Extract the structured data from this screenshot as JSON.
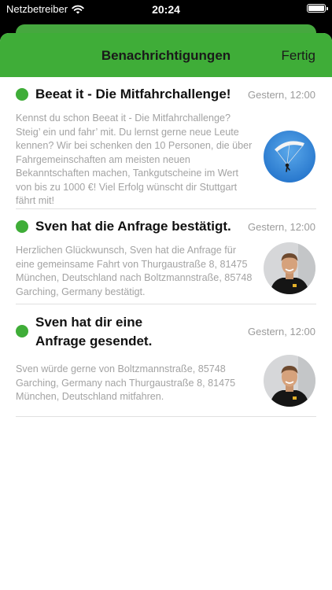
{
  "status_bar": {
    "carrier": "Netzbetreiber",
    "time": "20:24"
  },
  "nav": {
    "title": "Benachrichtigungen",
    "done_label": "Fertig"
  },
  "colors": {
    "accent": "#3fad38"
  },
  "notifications": [
    {
      "title": "Beeat it - Die Mitfahrchallenge!",
      "date": "Gestern, 12:00",
      "body": "Kennst du schon Beeat it - Die Mitfahrchallenge? Steig’ ein und fahr’ mit. Du lernst gerne neue Leute kennen? Wir bei schenken den 10 Personen, die über Fahrgemeinschaften am meisten neuen Bekanntschaften machen, Tankgutscheine im Wert von bis zu 1000 €! Viel Erfolg wünscht dir Stuttgart fährt mit!",
      "image": "parachute-photo"
    },
    {
      "title": "Sven hat die Anfrage bestätigt.",
      "date": "Gestern, 12:00",
      "body": "Herzlichen Glückwunsch, Sven hat die Anfrage für eine gemeinsame Fahrt von Thurgaustraße 8, 81475 München, Deutschland nach Boltzmannstraße, 85748 Garching, Germany bestätigt.",
      "image": "avatar-sven"
    },
    {
      "title": "Sven hat dir eine Anfrage gesendet.",
      "date": "Gestern, 12:00",
      "body": "Sven würde gerne von Boltzmannstraße, 85748 Garching, Germany nach Thurgaustraße 8, 81475 München, Deutschland mitfahren.",
      "image": "avatar-sven"
    }
  ]
}
